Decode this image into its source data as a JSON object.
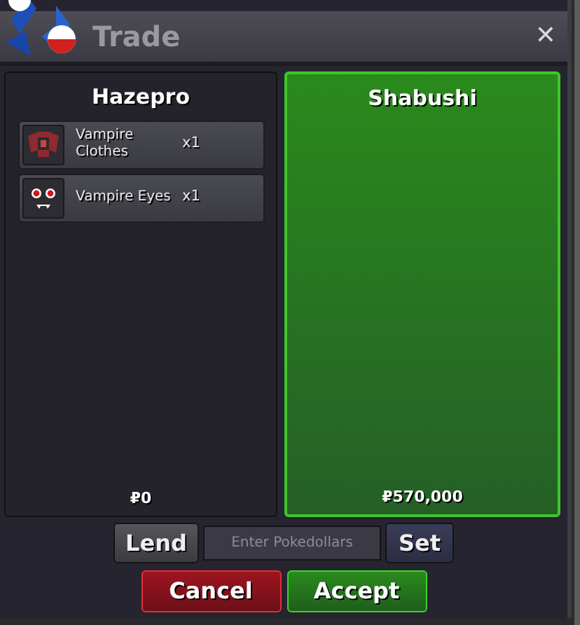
{
  "window": {
    "title": "Trade",
    "close": "✕"
  },
  "panels": [
    {
      "name": "Hazepro",
      "accepted": false,
      "money": "₽0",
      "items": [
        {
          "name": "Vampire Clothes",
          "qty": "x1",
          "kind": "clothes"
        },
        {
          "name": "Vampire Eyes",
          "qty": "x1",
          "kind": "eyes"
        }
      ]
    },
    {
      "name": "Shabushi",
      "accepted": true,
      "money": "₽570,000"
    }
  ],
  "money_field": {
    "placeholder": "Enter Pokedollars"
  },
  "buttons": {
    "lend": "Lend",
    "set": "Set",
    "cancel": "Cancel",
    "accept": "Accept"
  }
}
